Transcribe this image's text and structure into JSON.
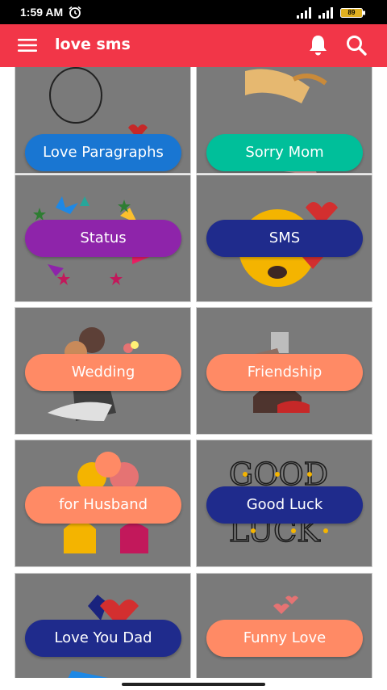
{
  "status_bar": {
    "time": "1:59 AM",
    "battery": "89",
    "icons": [
      "alarm-icon",
      "signal-icon",
      "signal-icon",
      "battery-icon"
    ]
  },
  "app_bar": {
    "title": "love sms",
    "background": "#f23648",
    "icons": [
      "menu-icon",
      "bell-icon",
      "search-icon"
    ]
  },
  "categories": [
    {
      "label": "Love Paragraphs",
      "color": "#1976d2"
    },
    {
      "label": "Sorry Mom",
      "color": "#00bf9a"
    },
    {
      "label": "Status",
      "color": "#8e24aa"
    },
    {
      "label": "SMS",
      "color": "#1f2b8c"
    },
    {
      "label": "Wedding",
      "color": "#ff8a65"
    },
    {
      "label": "Friendship",
      "color": "#ff8a65"
    },
    {
      "label": "for Husband",
      "color": "#ff8a65"
    },
    {
      "label": "Good Luck",
      "color": "#1f2b8c"
    },
    {
      "label": "Love You Dad",
      "color": "#1f2b8c"
    },
    {
      "label": "Funny Love",
      "color": "#ff8a65"
    }
  ]
}
